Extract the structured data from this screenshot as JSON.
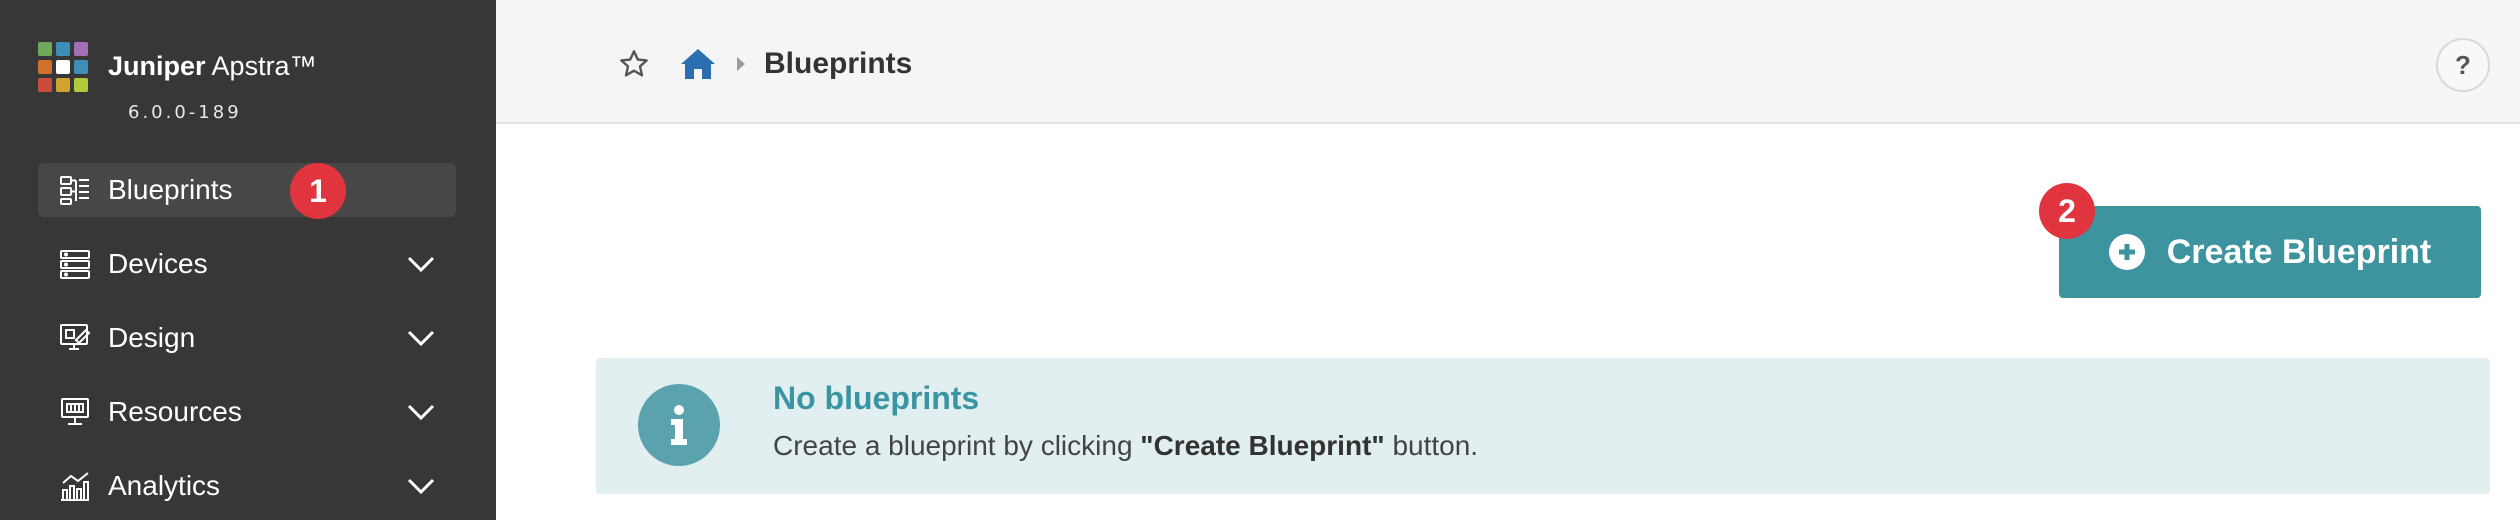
{
  "brand": {
    "name_bold": "Juniper",
    "name_rest": " Apstra™",
    "version": "6.0.0-189",
    "logo_colors": [
      "#6fa85a",
      "#3d8fb8",
      "#a46fb6",
      "#d0712c",
      "#ffffff",
      "#3d8fb8",
      "#c94c3d",
      "#d0a52f",
      "#b4c83b"
    ]
  },
  "sidebar": {
    "items": [
      {
        "label": "Blueprints",
        "icon": "blueprints-icon",
        "active": true
      },
      {
        "label": "Devices",
        "icon": "devices-icon",
        "expandable": true
      },
      {
        "label": "Design",
        "icon": "design-icon",
        "expandable": true
      },
      {
        "label": "Resources",
        "icon": "resources-icon",
        "expandable": true
      },
      {
        "label": "Analytics",
        "icon": "analytics-icon",
        "expandable": true
      }
    ]
  },
  "header": {
    "star_icon": "star-icon",
    "home_icon": "home-icon",
    "title": "Blueprints",
    "help_label": "?"
  },
  "badges": {
    "step1": "1",
    "step2": "2",
    "color": "#e0343f"
  },
  "actions": {
    "create_label": "Create Blueprint",
    "create_color": "#3d949f"
  },
  "info": {
    "title": "No blueprints",
    "text_before": "Create a blueprint by clicking ",
    "text_bold": "\"Create Blueprint\"",
    "text_after": " button.",
    "background": "#e1eff0"
  }
}
